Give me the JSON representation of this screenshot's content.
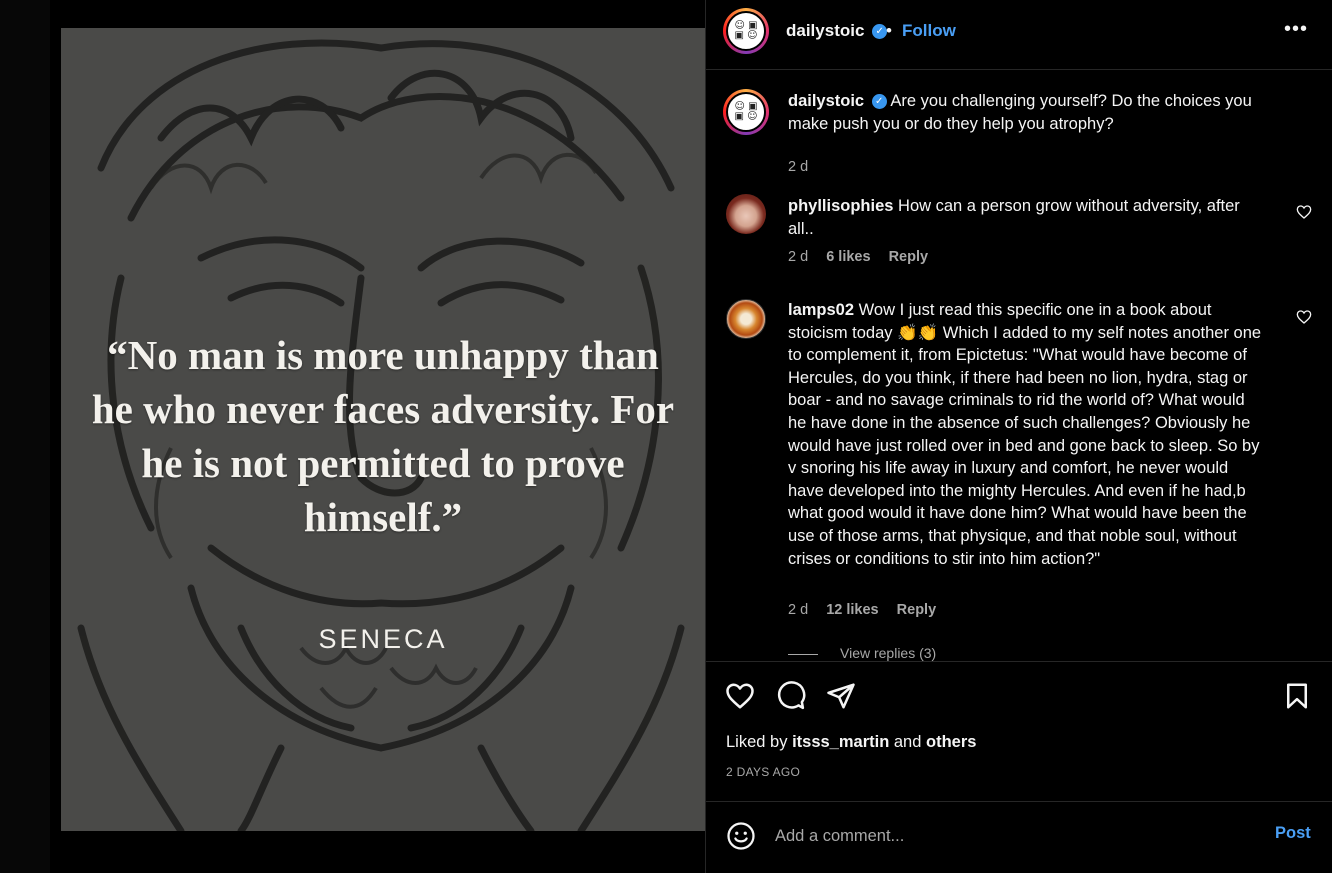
{
  "post_image": {
    "quote": "“No man is more unhappy than he who never faces adversity. For he is not permitted to prove himself.”",
    "author": "SENECA"
  },
  "header": {
    "username": "dailystoic",
    "verified_icon": "verified-badge-icon",
    "separator": "•",
    "follow_label": "Follow",
    "more_label": "•••"
  },
  "caption": {
    "username": "dailystoic",
    "text": "Are you challenging yourself? Do the choices you make push you or do they help you atrophy?",
    "time": "2 d"
  },
  "comments": [
    {
      "username": "phyllisophies",
      "text": "How can a person grow without adversity, after all..",
      "time": "2 d",
      "likes": "6 likes",
      "reply_label": "Reply"
    },
    {
      "username": "lamps02",
      "text": "Wow I just read this specific one in a book about stoicism today 👏👏 Which I added to my self notes another one to complement it, from Epictetus: \"What would have become of Hercules, do you think, if there had been no lion, hydra, stag or boar - and no savage criminals to rid the world of? What would he have done in the absence of such challenges? Obviously he would have just rolled over in bed and gone back to sleep. So by v snoring his life away in luxury and comfort, he never would have developed into the mighty Hercules. And even if he had,b what good would it have done him? What would have been the use of those arms, that physique, and that noble soul, without crises or conditions to stir into him action?\"",
      "time": "2 d",
      "likes": "12 likes",
      "reply_label": "Reply",
      "view_replies": "View replies (3)"
    }
  ],
  "actions": {
    "like_icon": "heart-icon",
    "comment_icon": "comment-bubble-icon",
    "share_icon": "paper-plane-icon",
    "save_icon": "bookmark-icon"
  },
  "likes_summary": {
    "prefix": "Liked by",
    "user": "itsss_martin",
    "conjunction": "and",
    "others": "others"
  },
  "timestamp": "2 DAYS AGO",
  "add_comment": {
    "emoji_icon": "smiley-icon",
    "placeholder": "Add a comment...",
    "post_label": "Post"
  },
  "colors": {
    "accent_blue": "#4a9ff5",
    "panel_bg": "#000000",
    "muted_text": "#a8a8a8",
    "divider": "#262626"
  }
}
